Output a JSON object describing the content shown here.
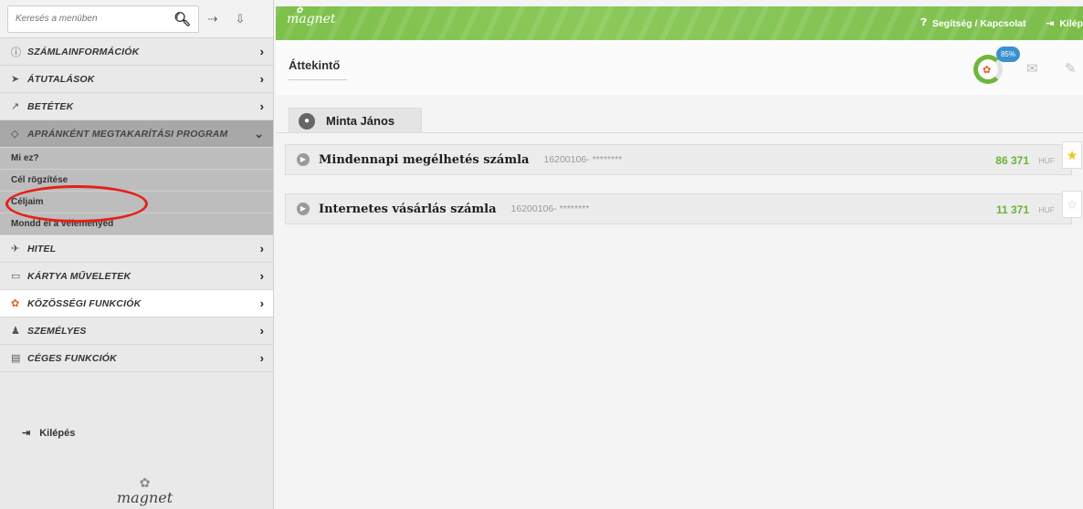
{
  "sidebar": {
    "search_placeholder": "Keresés a menüben",
    "items": [
      {
        "label": "SZÁMLAINFORMÁCIÓK",
        "icon": "info-icon"
      },
      {
        "label": "ÁTUTALÁSOK",
        "icon": "arrow-circle-icon"
      },
      {
        "label": "BETÉTEK",
        "icon": "chart-icon"
      },
      {
        "label": "APRÁNKÉNT MEGTAKARÍTÁSI PROGRAM",
        "icon": "diamond-icon"
      },
      {
        "label": "HITEL",
        "icon": "plane-icon"
      },
      {
        "label": "KÁRTYA MŰVELETEK",
        "icon": "card-icon"
      },
      {
        "label": "KÖZÖSSÉGI FUNKCIÓK",
        "icon": "community-icon"
      },
      {
        "label": "SZEMÉLYES",
        "icon": "user-icon"
      },
      {
        "label": "CÉGES FUNKCIÓK",
        "icon": "building-icon"
      }
    ],
    "subitems": [
      "Mi ez?",
      "Cél rögzítése",
      "Céljaim",
      "Mondd el a véleményed"
    ],
    "logout": "Kilépés",
    "logo": "magnet"
  },
  "topbar": {
    "brand": "magnet",
    "help": "Segítség / Kapcsolat",
    "logout": "Kilép"
  },
  "main": {
    "title": "Áttekintő",
    "progress_badge": "85%",
    "user_name": "Minta János",
    "accounts": [
      {
        "name": "Mindennapi megélhetés számla",
        "number": "16200106- ********",
        "amount": "86 371",
        "currency": "HUF",
        "starred": true
      },
      {
        "name": "Internetes vásárlás számla",
        "number": "16200106- ********",
        "amount": "11 371",
        "currency": "HUF",
        "starred": false
      }
    ]
  },
  "colors": {
    "accent_green": "#6ab23a",
    "topbar_green": "#82c350",
    "annotation_red": "#e32119"
  }
}
